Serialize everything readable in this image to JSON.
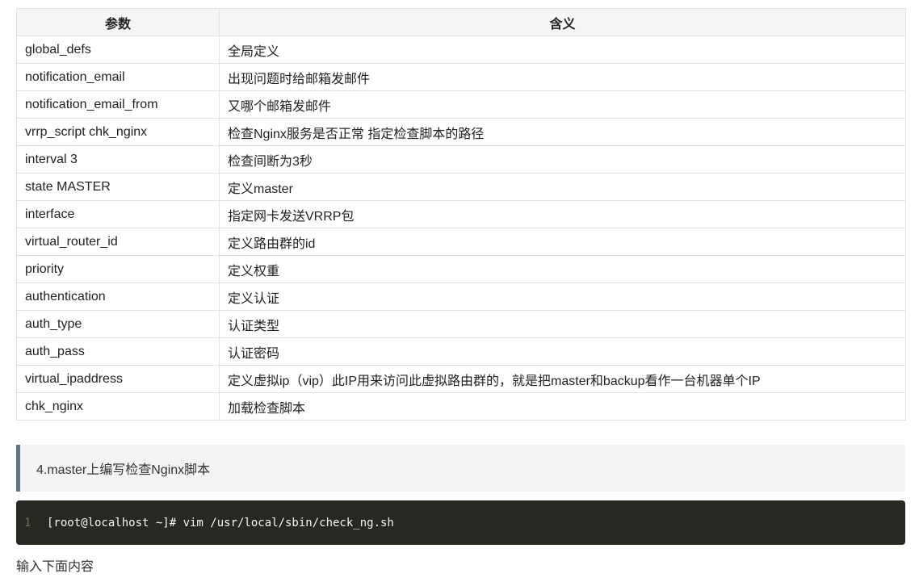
{
  "table": {
    "headers": [
      "参数",
      "含义"
    ],
    "rows": [
      [
        "global_defs",
        "全局定义"
      ],
      [
        "notification_email",
        "出现问题时给邮箱发邮件"
      ],
      [
        "notification_email_from",
        "又哪个邮箱发邮件"
      ],
      [
        "vrrp_script chk_nginx",
        "检查Nginx服务是否正常 指定检查脚本的路径"
      ],
      [
        "interval 3",
        "检查间断为3秒"
      ],
      [
        "state MASTER",
        "定义master"
      ],
      [
        "interface",
        "指定网卡发送VRRP包"
      ],
      [
        "virtual_router_id",
        "定义路由群的id"
      ],
      [
        "priority",
        "定义权重"
      ],
      [
        "authentication",
        "定义认证"
      ],
      [
        "auth_type",
        "认证类型"
      ],
      [
        "auth_pass",
        "认证密码"
      ],
      [
        "virtual_ipaddress",
        "定义虚拟ip（vip）此IP用来访问此虚拟路由群的，就是把master和backup看作一台机器单个IP"
      ],
      [
        "chk_nginx",
        "加载检查脚本"
      ]
    ]
  },
  "blockquote": {
    "text": "4.master上编写检查Nginx脚本"
  },
  "code_block": {
    "line_number": "1",
    "code": "[root@localhost ~]# vim /usr/local/sbin/check_ng.sh"
  },
  "paragraph": {
    "text": "输入下面内容"
  }
}
